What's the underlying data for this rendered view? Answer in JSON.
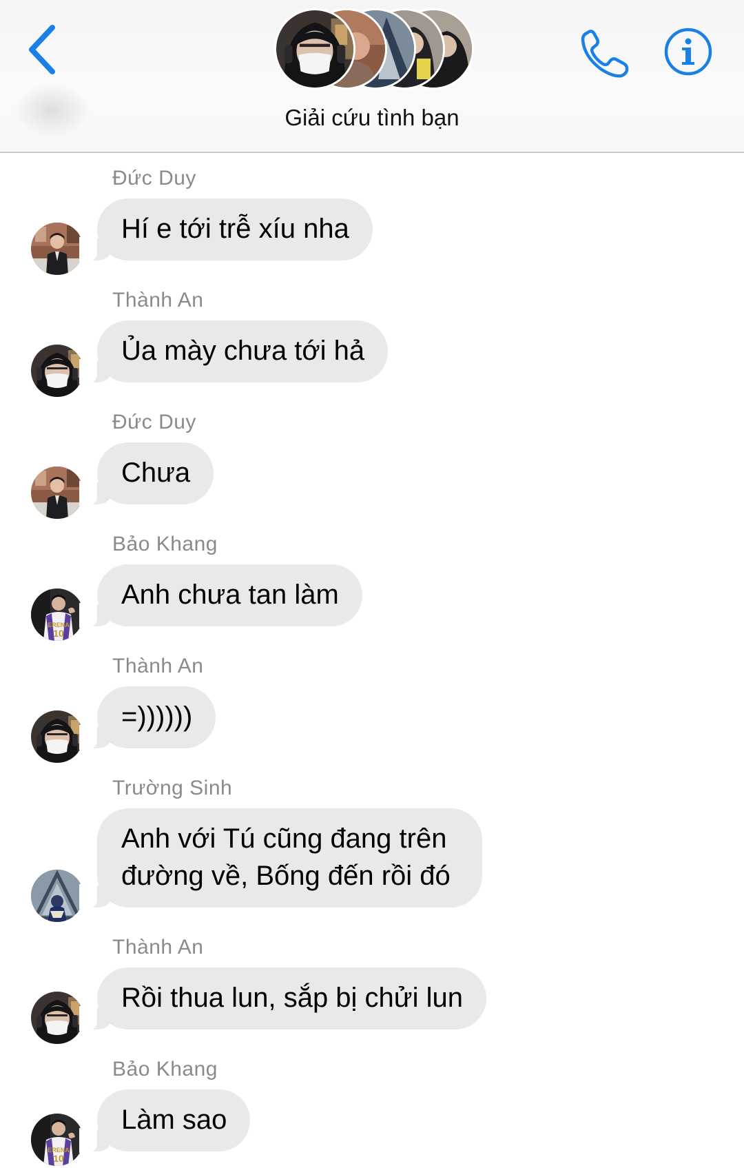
{
  "header": {
    "title": "Giải cứu tình bạn",
    "back_icon": "chevron-left-icon",
    "call_icon": "phone-icon",
    "info_icon": "info-icon",
    "accent_color": "#1a80e5"
  },
  "messages": [
    {
      "sender": "Đức Duy",
      "text": "Hí e tới trễ xíu nha",
      "avatar": "duc-duy"
    },
    {
      "sender": "Thành An",
      "text": "Ủa mày chưa tới hả",
      "avatar": "thanh-an"
    },
    {
      "sender": "Đức Duy",
      "text": "Chưa",
      "avatar": "duc-duy"
    },
    {
      "sender": "Bảo Khang",
      "text": "Anh chưa tan làm",
      "avatar": "bao-khang"
    },
    {
      "sender": "Thành An",
      "text": "=))))))",
      "avatar": "thanh-an"
    },
    {
      "sender": "Trường Sinh",
      "text": "Anh với Tú cũng đang trên đường về, Bống đến rồi đó",
      "avatar": "truong-sinh"
    },
    {
      "sender": "Thành An",
      "text": "Rồi thua lun, sắp bị chửi lun",
      "avatar": "thanh-an"
    },
    {
      "sender": "Bảo Khang",
      "text": "Làm sao",
      "avatar": "bao-khang"
    }
  ],
  "colors": {
    "bubble": "#e9e9eb",
    "sender_text": "#8a8a8e",
    "header_bg": "#f7f7f8"
  }
}
